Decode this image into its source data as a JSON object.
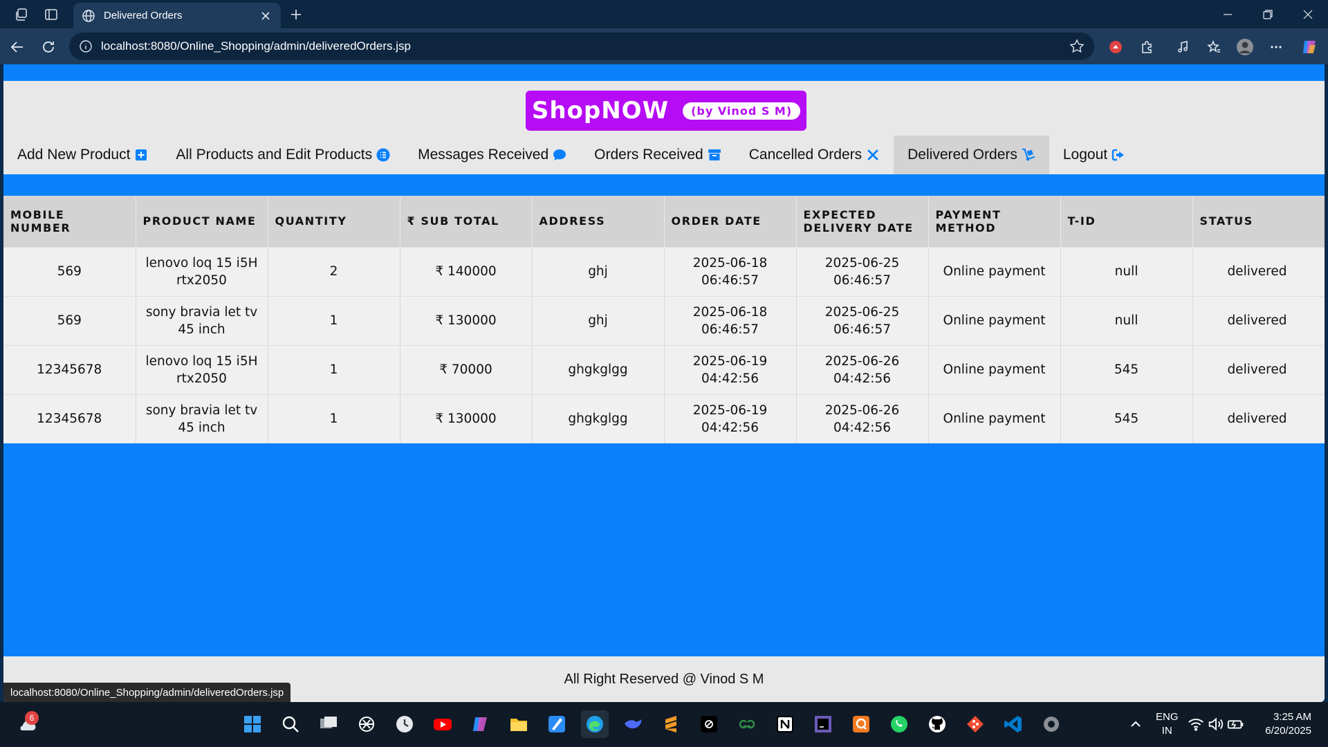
{
  "browser": {
    "tab_title": "Delivered Orders",
    "url": "localhost:8080/Online_Shopping/admin/deliveredOrders.jsp",
    "status_url": "localhost:8080/Online_Shopping/admin/deliveredOrders.jsp"
  },
  "header": {
    "brand": "ShopNOW",
    "byline": "(by Vinod S M)"
  },
  "menu": {
    "items": [
      {
        "label": "Add New Product",
        "icon": "plus-square-icon"
      },
      {
        "label": "All Products and Edit Products",
        "icon": "list-icon"
      },
      {
        "label": "Messages Received",
        "icon": "comment-icon"
      },
      {
        "label": "Orders Received",
        "icon": "archive-icon"
      },
      {
        "label": "Cancelled Orders",
        "icon": "close-icon"
      },
      {
        "label": "Delivered Orders",
        "icon": "dolly-icon"
      },
      {
        "label": "Logout",
        "icon": "sign-out-icon"
      }
    ],
    "active": "Delivered Orders"
  },
  "table": {
    "columns": [
      "MOBILE NUMBER",
      "PRODUCT NAME",
      "QUANTITY",
      "₹ SUB TOTAL",
      "ADDRESS",
      "ORDER DATE",
      "EXPECTED DELIVERY DATE",
      "PAYMENT METHOD",
      "T-ID",
      "STATUS"
    ],
    "rows": [
      {
        "mobile": "569",
        "product": "lenovo loq 15 i5H rtx2050",
        "quantity": "2",
        "subtotal": "₹ 140000",
        "address": "ghj",
        "order_date": "2025-06-18 06:46:57",
        "delivery_date": "2025-06-25 06:46:57",
        "payment": "Online payment",
        "tid": "null",
        "status": "delivered"
      },
      {
        "mobile": "569",
        "product": "sony bravia let tv 45 inch",
        "quantity": "1",
        "subtotal": "₹ 130000",
        "address": "ghj",
        "order_date": "2025-06-18 06:46:57",
        "delivery_date": "2025-06-25 06:46:57",
        "payment": "Online payment",
        "tid": "null",
        "status": "delivered"
      },
      {
        "mobile": "12345678",
        "product": "lenovo loq 15 i5H rtx2050",
        "quantity": "1",
        "subtotal": "₹ 70000",
        "address": "ghgkglgg",
        "order_date": "2025-06-19 04:42:56",
        "delivery_date": "2025-06-26 04:42:56",
        "payment": "Online payment",
        "tid": "545",
        "status": "delivered"
      },
      {
        "mobile": "12345678",
        "product": "sony bravia let tv 45 inch",
        "quantity": "1",
        "subtotal": "₹ 130000",
        "address": "ghgkglgg",
        "order_date": "2025-06-19 04:42:56",
        "delivery_date": "2025-06-26 04:42:56",
        "payment": "Online payment",
        "tid": "545",
        "status": "delivered"
      }
    ]
  },
  "footer": {
    "text": "All Right Reserved @ Vinod S M"
  },
  "taskbar": {
    "notification_count": "6",
    "language": "ENG",
    "region": "IN",
    "time": "3:25 AM",
    "date": "6/20/2025"
  },
  "colors": {
    "page_background": "#0a81fb",
    "brand": "#b60bf5",
    "panel": "#e8e8e8",
    "active_menu": "#d3d3d3"
  }
}
